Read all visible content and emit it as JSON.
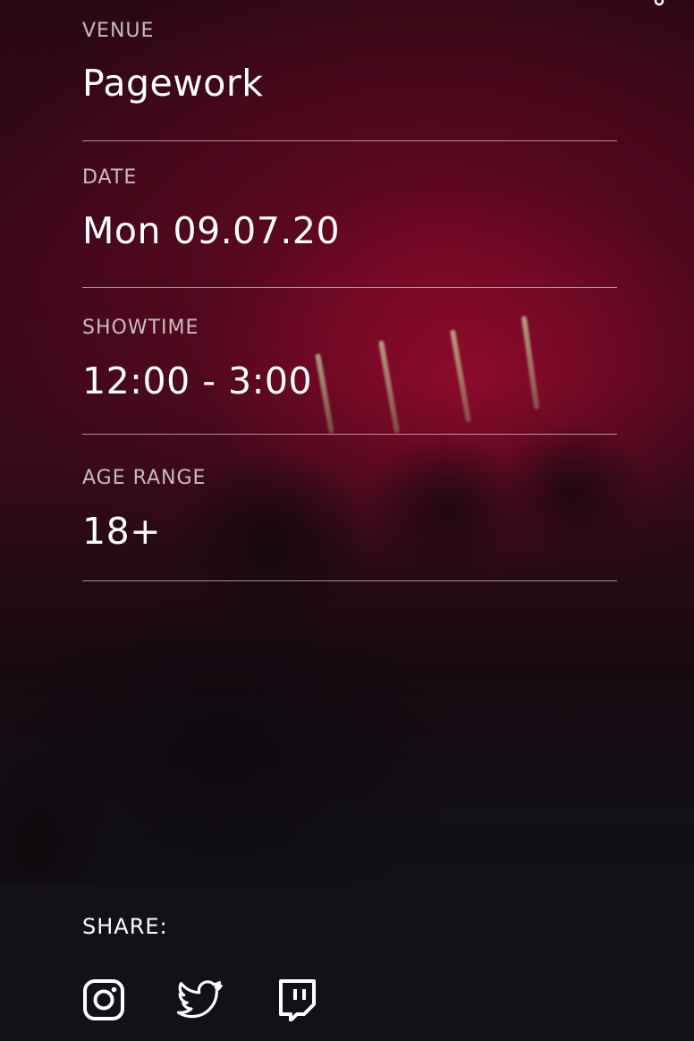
{
  "details": [
    {
      "key": "venue",
      "label": "VENUE",
      "value": "Pagework"
    },
    {
      "key": "date",
      "label": "DATE",
      "value": "Mon 09.07.20"
    },
    {
      "key": "showtime",
      "label": "SHOWTIME",
      "value": "12:00 - 3:00"
    },
    {
      "key": "age",
      "label": "AGE RANGE",
      "value": "18+"
    }
  ],
  "share": {
    "label": "SHARE:",
    "icons": [
      "instagram-icon",
      "twitter-icon",
      "twitch-icon"
    ]
  },
  "colors": {
    "background": "#121117",
    "accent_red": "#6e0824",
    "text": "#ffffff",
    "divider": "#b3b3b3"
  }
}
